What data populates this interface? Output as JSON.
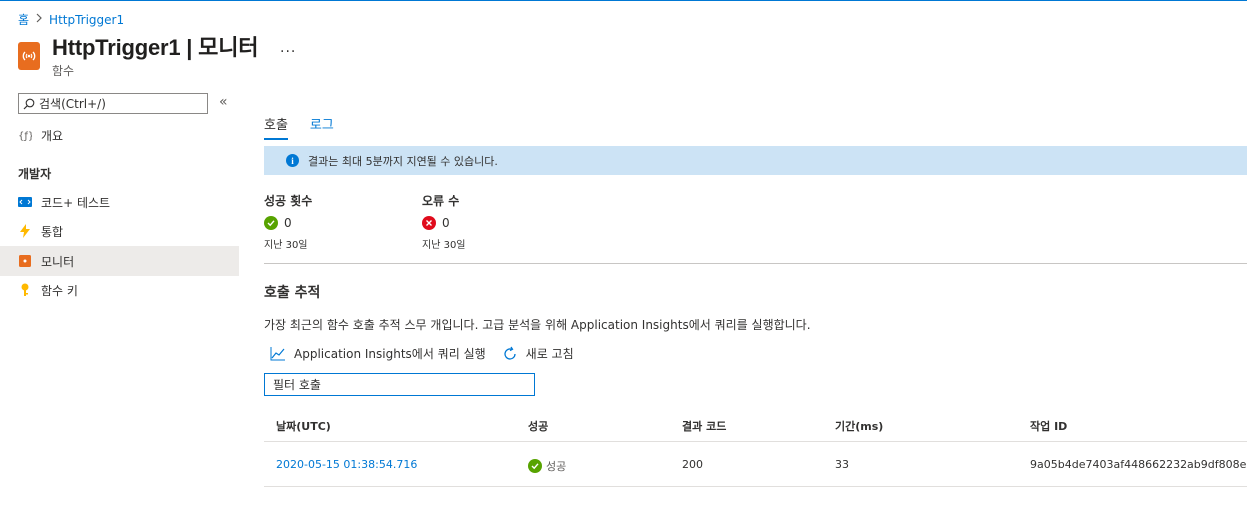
{
  "breadcrumb": {
    "home": "홈",
    "current": "HttpTrigger1"
  },
  "header": {
    "title": "HttpTrigger1 | 모니터",
    "subtitle": "함수",
    "more": "···"
  },
  "sidebar": {
    "search_placeholder": "검색(Ctrl+/)",
    "collapse": "«",
    "overview": "개요",
    "group_label": "개발자",
    "items": [
      {
        "label": "코드+ 테스트",
        "icon": "code-test-icon"
      },
      {
        "label": "통합",
        "icon": "lightning-icon"
      },
      {
        "label": "모니터",
        "icon": "monitor-icon",
        "active": true
      },
      {
        "label": "함수 키",
        "icon": "key-icon"
      }
    ]
  },
  "tabs": [
    {
      "label": "호출",
      "active": true
    },
    {
      "label": "로그",
      "active": false
    }
  ],
  "info": {
    "text": "결과는 최대 5분까지 지연될 수 있습니다."
  },
  "stats": {
    "success": {
      "label": "성공 횟수",
      "value": "0",
      "period": "지난 30일"
    },
    "error": {
      "label": "오류 수",
      "value": "0",
      "period": "지난 30일"
    }
  },
  "trace": {
    "title": "호출 추적",
    "description": "가장 최근의 함수 호출 추적 스무 개입니다. 고급 분석을 위해 Application Insights에서 쿼리를 실행합니다.",
    "run_query": "Application Insights에서 쿼리 실행",
    "refresh": "새로 고침",
    "filter_placeholder": "필터 호출"
  },
  "table": {
    "headers": [
      "날짜(UTC)",
      "성공",
      "결과 코드",
      "기간(ms)",
      "작업 ID"
    ],
    "rows": [
      {
        "date": "2020-05-15 01:38:54.716",
        "success": "성공",
        "code": "200",
        "duration": "33",
        "op_id": "9a05b4de7403af448662232ab9df808e"
      }
    ]
  },
  "colors": {
    "accent": "#0078d4",
    "info_bg": "#cce3f5",
    "success": "#57a300",
    "error": "#e00b1c",
    "function_orange": "#e86d1f"
  }
}
